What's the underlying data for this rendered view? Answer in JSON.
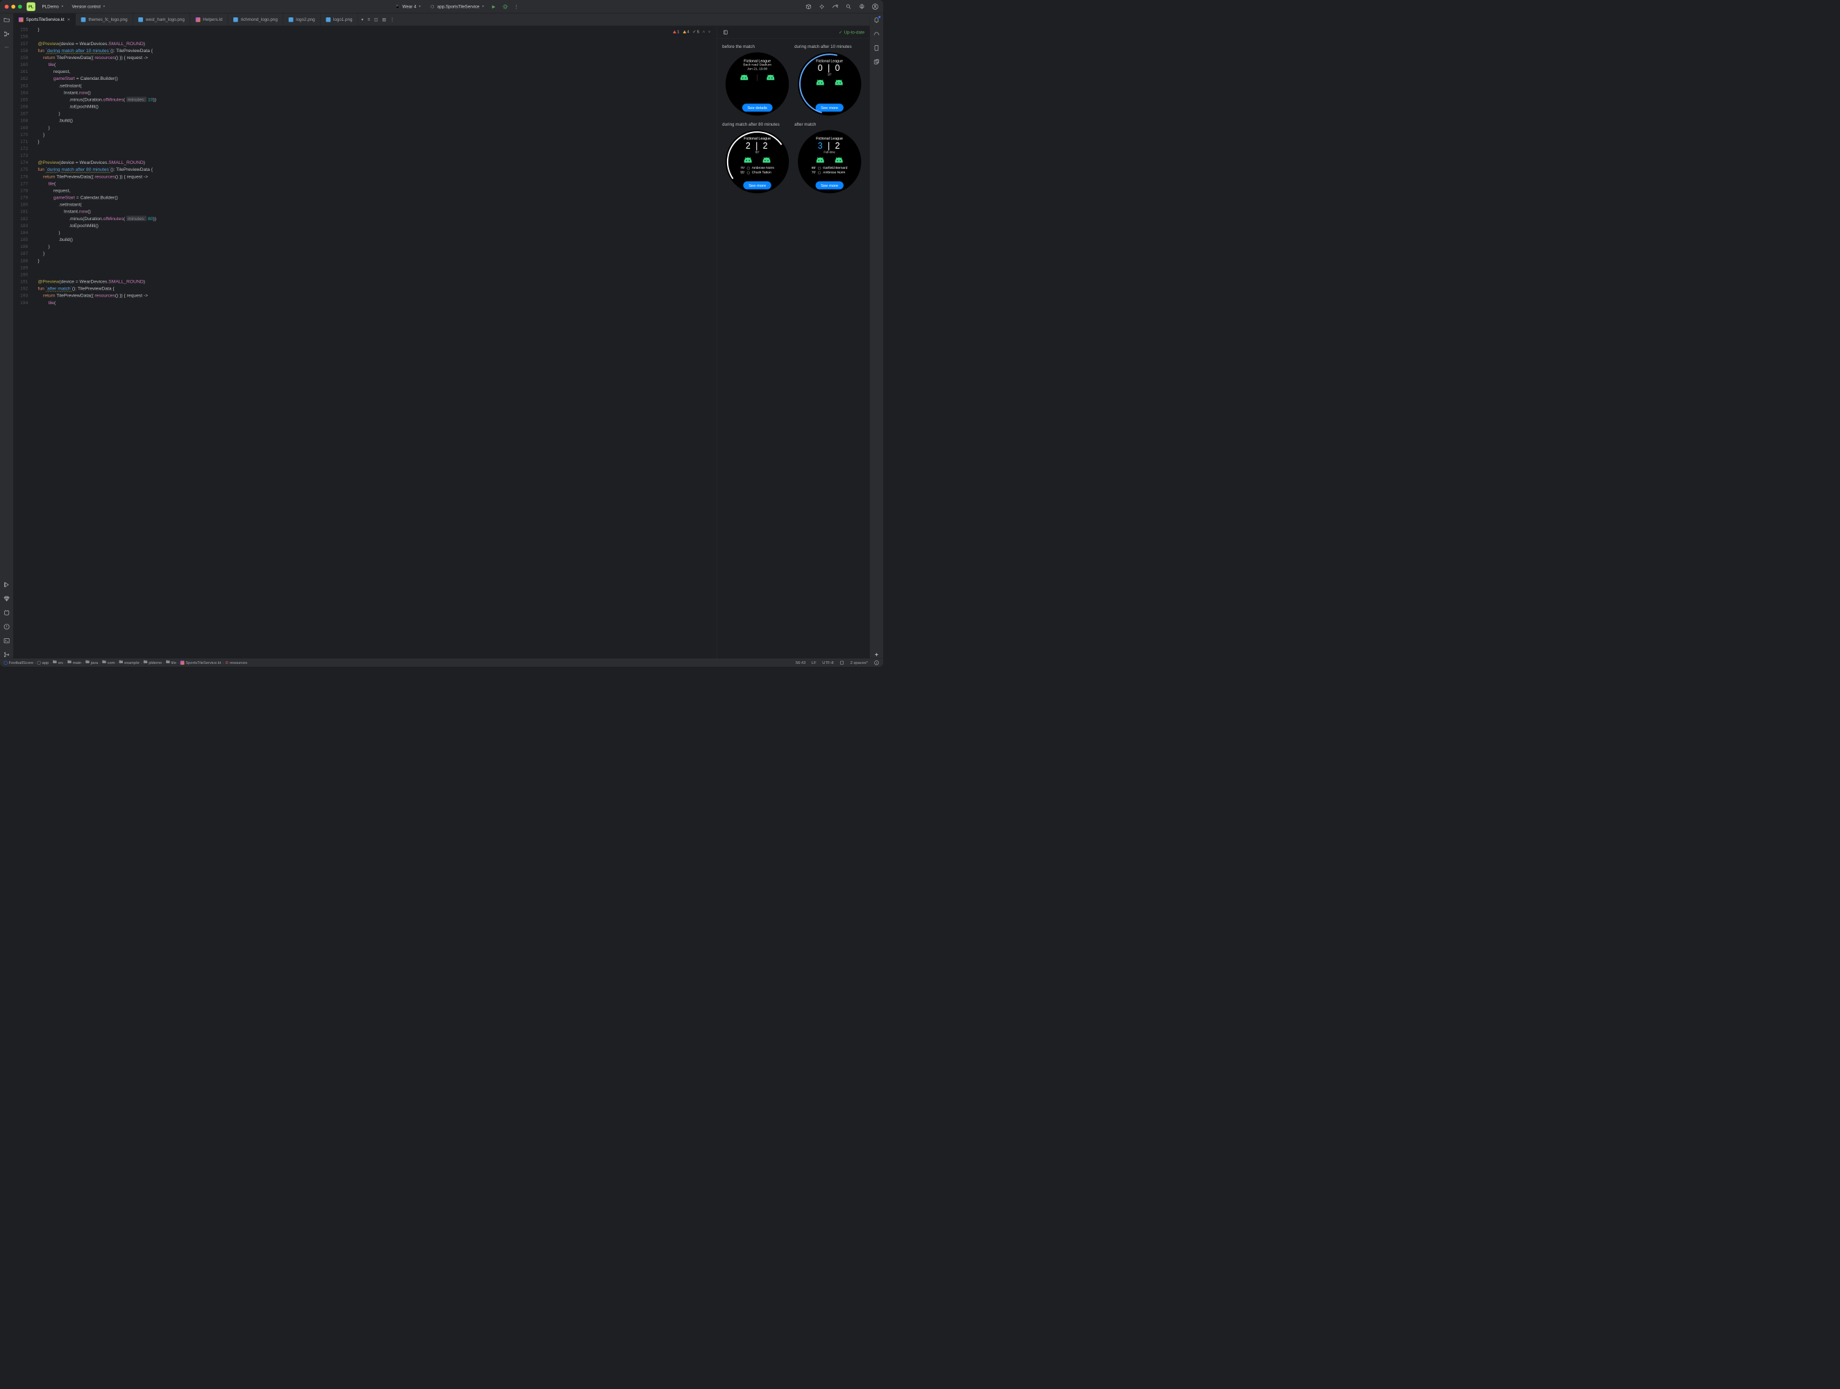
{
  "title": {
    "badge": "PL",
    "project": "PLDemo",
    "vcs": "Version control"
  },
  "run": {
    "device": "Wear 4",
    "config": "app.SportsTileService"
  },
  "tabs": [
    {
      "label": "SportsTileService.kt",
      "type": "kt",
      "active": true
    },
    {
      "label": "themes_fc_logo.png",
      "type": "img"
    },
    {
      "label": "west_ham_logo.png",
      "type": "img"
    },
    {
      "label": "Helpers.kt",
      "type": "kt"
    },
    {
      "label": "richmond_logo.png",
      "type": "img"
    },
    {
      "label": "logo2.png",
      "type": "img"
    },
    {
      "label": "logo1.png",
      "type": "img"
    }
  ],
  "inspections": {
    "errors": "1",
    "warnings": "4",
    "ok": "5"
  },
  "gutterStart": 155,
  "code": {
    "preview_annotation": "@Preview",
    "preview_args": "(device = WearDevices.",
    "preview_const": "SMALL_ROUND",
    "fun_kw": "fun",
    "return_kw": "return",
    "resources": "resources",
    "request": "request",
    "tile": "tile",
    "gameStart": "gameStart",
    "calendar": "Calendar",
    "builder": "Builder",
    "setInstant": ".setInstant(",
    "instant": "Instant",
    "now": "now",
    "minus": ".minus(Duration.",
    "ofMinutes": "ofMinutes",
    "hint_min": "minutes:",
    "v10": "10",
    "v80": "80",
    "toEpoch": ".toEpochMilli()",
    "build": ".build()",
    "tpd": "TilePreviewData",
    "tpd_open": "({ ",
    "tpd_close": "() }) { request ->",
    "fn10": "`during match after 10 minutes`",
    "fn80": "`during match after 80 minutes`",
    "fnAfter": "`after match`",
    "sig": "(): TilePreviewData {"
  },
  "preview": {
    "status": "Up-to-date",
    "cards": [
      {
        "title": "before the match",
        "league": "Fictional League",
        "line1": "Back road Stadium",
        "line2": "Jun 21, 19:00",
        "button": "See details",
        "arc": "none"
      },
      {
        "title": "during match after 10 minutes",
        "league": "Fictional League",
        "score": "0 | 0",
        "min": "10'",
        "button": "See more",
        "arc": "partial"
      },
      {
        "title": "during match after 80 minutes",
        "league": "Fictional League",
        "score": "2 | 2",
        "min": "80'",
        "button": "See more",
        "arc": "half",
        "scorers": [
          [
            "70'",
            "Ambrose Norm"
          ],
          [
            "55'",
            "Chuck Tatton"
          ]
        ]
      },
      {
        "title": "after match",
        "league": "Fictional League",
        "score_html": [
          "3",
          " | 2"
        ],
        "min": "Full-time",
        "button": "See more",
        "arc": "none",
        "scorers": [
          [
            "85'",
            "Garfield Bernard"
          ],
          [
            "70'",
            "Ambrose Norm"
          ]
        ]
      }
    ]
  },
  "breadcrumbs": [
    "FootballScore",
    "app",
    "src",
    "main",
    "java",
    "com",
    "example",
    "pldemo",
    "tile",
    "SportsTileService.kt",
    "resources"
  ],
  "status": {
    "pos": "56:43",
    "le": "LF",
    "enc": "UTF-8",
    "indent": "2 spaces*"
  }
}
